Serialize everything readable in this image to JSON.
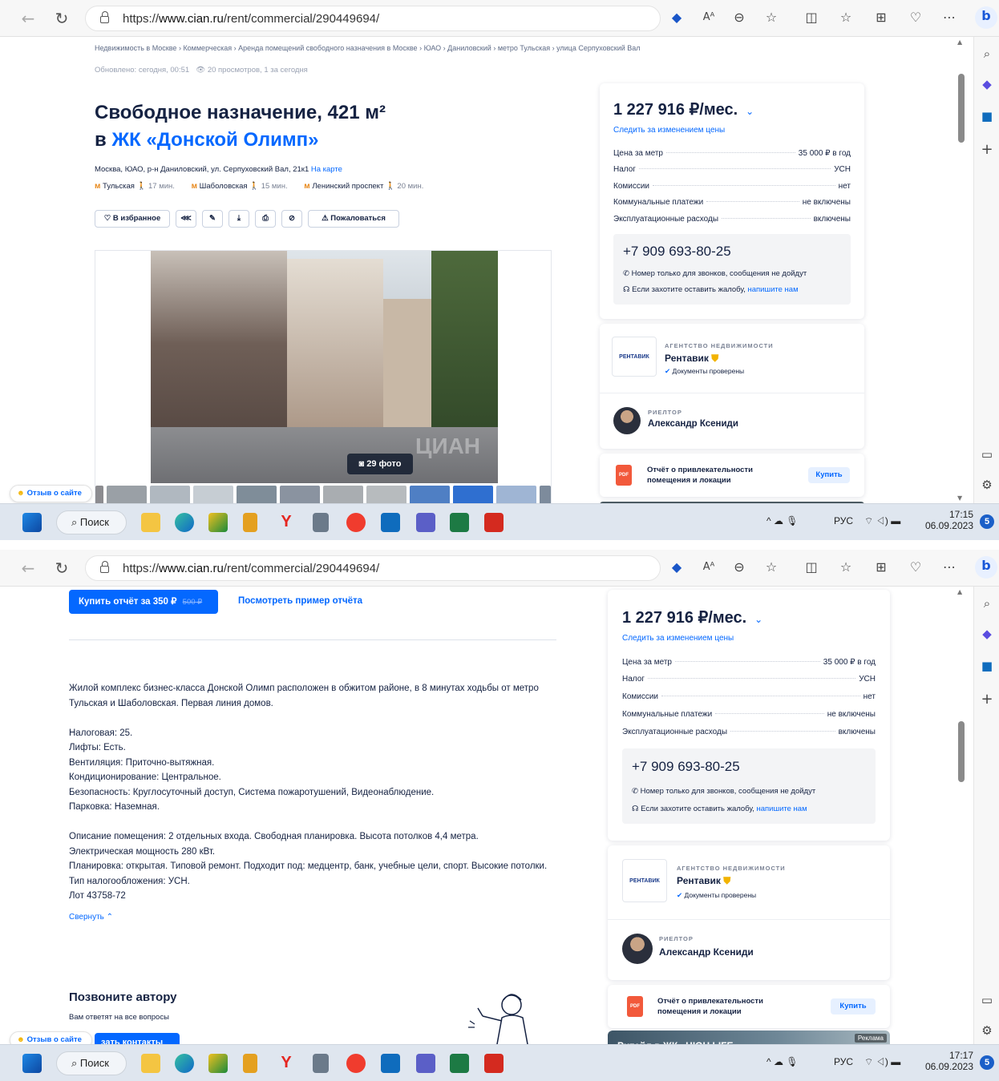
{
  "browser": {
    "url_prefix": "https://",
    "url_domain": "www.cian.ru",
    "url_path": "/rent/commercial/290449694/"
  },
  "listing": {
    "breadcrumbs": [
      "Недвижимость в Москве",
      "Коммерческая",
      "Аренда помещений свободного назначения в Москве",
      "ЮАО",
      "Даниловский",
      "метро Тульская",
      "улица Серпуховский Вал"
    ],
    "updated": "Обновлено: сегодня, 00:51",
    "views": "20 просмотров, 1 за сегодня",
    "title_line1": "Свободное назначение, 421 м²",
    "title_prefix": "в",
    "title_complex": "ЖК «Донской Олимп»",
    "address": "Москва, ЮАО, р-н Даниловский, ул. Серпуховский Вал, 21к1",
    "map_link": "На карте",
    "metros": [
      {
        "name": "Тульская",
        "time": "17 мин."
      },
      {
        "name": "Шаболовская",
        "time": "15 мин."
      },
      {
        "name": "Ленинский проспект",
        "time": "20 мин."
      }
    ],
    "actions": {
      "favorite": "В избранное",
      "complain": "Пожаловаться"
    },
    "photo_count": "29 фото",
    "watermark": "ЦИАН"
  },
  "price_card": {
    "price": "1 227 916 ₽/мес.",
    "follow": "Следить за изменением цены",
    "rows": [
      {
        "label": "Цена за метр",
        "value": "35 000 ₽ в год"
      },
      {
        "label": "Налог",
        "value": "УСН"
      },
      {
        "label": "Комиссии",
        "value": "нет"
      },
      {
        "label": "Коммунальные платежи",
        "value": "не включены"
      },
      {
        "label": "Эксплуатационные расходы",
        "value": "включены"
      }
    ],
    "phone": "+7 909 693-80-25",
    "phone_note": "Номер только для звонков, сообщения не дойдут",
    "complaint_text": "Если захотите оставить жалобу,",
    "complaint_link": "напишите нам"
  },
  "agency": {
    "caption": "АГЕНТСТВО НЕДВИЖИМОСТИ",
    "logo_text": "РЕНТАВИК",
    "name": "Рентавик",
    "verified": "Документы проверены",
    "realtor_caption": "РИЕЛТОР",
    "realtor_name": "Александр Ксениди"
  },
  "report": {
    "title": "Отчёт о привлекательности помещения и локации",
    "buy": "Купить",
    "pdf": "PDF",
    "buy_report": "Купить отчёт за 350 ₽",
    "old_price": "500 ₽",
    "sample": "Посмотреть пример отчёта"
  },
  "description": {
    "p1": "Жилой комплекс бизнес-класса Донской Олимп расположен в обжитом районе, в 8 минутах ходьбы от метро Тульская и Шаболовская. Первая линия домов.",
    "specs": [
      "Налоговая: 25.",
      "Лифты: Есть.",
      "Вентиляция: Приточно-вытяжная.",
      "Кондиционирование: Центральное.",
      "Безопасность: Круглосуточный доступ, Система пожаротушений, Видеонаблюдение.",
      "Парковка: Наземная."
    ],
    "p3": [
      "Описание помещения:  2 отдельных входа. Свободная планировка. Высота потолков 4,4 метра.",
      "Электрическая мощность 280 кВт.",
      "Планировка: открытая. Типовой ремонт. Подходит под: медцентр, банк, учебные цели, спорт. Высокие потолки. Тип налогообложения: УСН.",
      "Лот 43758-72"
    ],
    "collapse": "Свернуть"
  },
  "call": {
    "title": "Позвоните автору",
    "subtitle": "Вам ответят на все вопросы",
    "show_contacts": "зать контакты"
  },
  "ad": {
    "title": "Ритейл в ЖК «HIGH LIFE»",
    "label": "Реклама"
  },
  "feedback": "Отзыв о сайте",
  "taskbar": {
    "search": "Поиск",
    "lang": "РУС",
    "time1": "17:15",
    "date1": "06.09.2023",
    "time2": "17:17",
    "date2": "06.09.2023",
    "badge": "5"
  }
}
